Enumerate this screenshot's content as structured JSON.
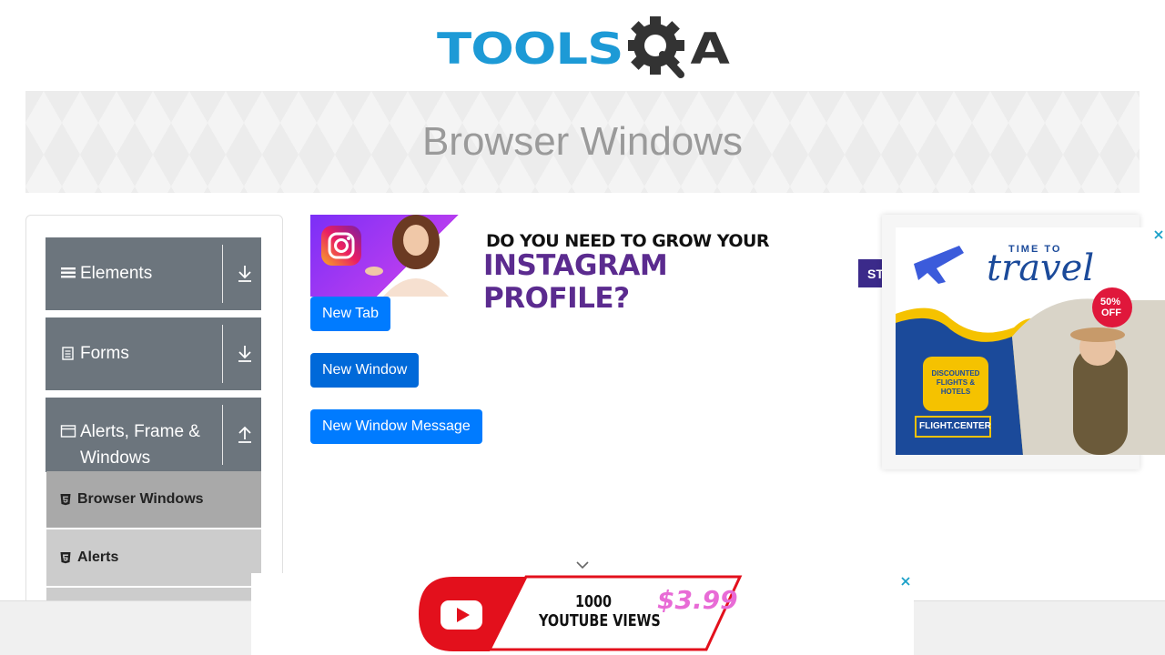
{
  "header": {
    "logo_tools": "TOOLS",
    "logo_a": "A"
  },
  "banner": {
    "title": "Browser Windows"
  },
  "sidebar": {
    "groups": [
      {
        "label": "Elements",
        "icon": "hamburger-icon",
        "expanded": false
      },
      {
        "label": "Forms",
        "icon": "document-icon",
        "expanded": false
      },
      {
        "label": "Alerts, Frame & Windows",
        "icon": "window-icon",
        "expanded": true
      }
    ],
    "items": [
      {
        "label": "Browser Windows",
        "icon": "html5-icon",
        "active": true
      },
      {
        "label": "Alerts",
        "icon": "html5-icon",
        "active": false
      }
    ]
  },
  "main": {
    "buttons": [
      {
        "label": "New Tab"
      },
      {
        "label": "New Window"
      },
      {
        "label": "New Window Message"
      }
    ]
  },
  "ads": {
    "instagram": {
      "line1": "DO YOU NEED TO GROW YOUR",
      "line2": "INSTAGRAM PROFILE?",
      "cta_partial": "ST"
    },
    "travel": {
      "line1": "TIME TO",
      "line2": "travel",
      "badge_pct": "50%",
      "badge_off": "OFF",
      "bubble": "DISCOUNTED FLIGHTS & HOTELS",
      "brand": "FLIGHT.CENTER"
    },
    "youtube": {
      "line1": "1000",
      "line2": "YOUTUBE VIEWS",
      "price": "$3.99"
    }
  },
  "colors": {
    "brand_blue": "#1d9ad6",
    "primary_button": "#007bff",
    "sidebar_group": "#6c757d",
    "active_item": "#a9a9a9",
    "inactive_item": "#cccccc"
  }
}
